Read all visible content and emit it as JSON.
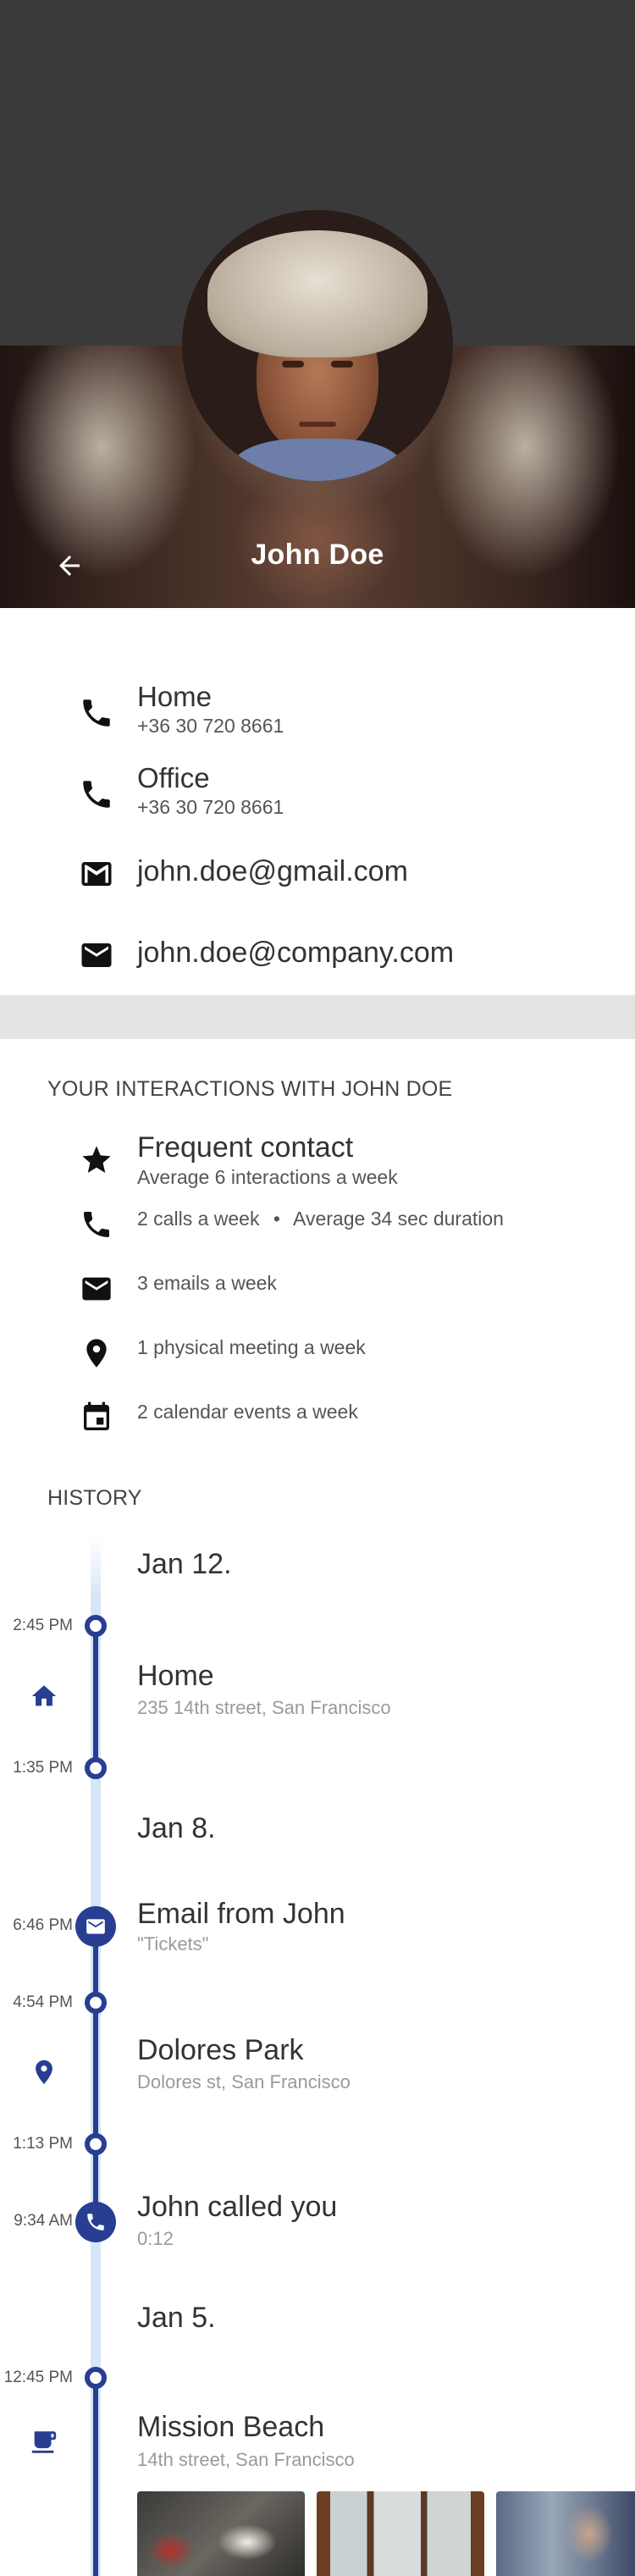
{
  "header": {
    "name": "John Doe",
    "back_icon": "arrow-back-icon"
  },
  "contacts": [
    {
      "icon": "phone-icon",
      "title": "Home",
      "number": "+36 30 720 8661"
    },
    {
      "icon": "phone-icon",
      "title": "Office",
      "number": "+36 30 720 8661"
    },
    {
      "icon": "email-icon",
      "email": "john.doe@gmail.com"
    },
    {
      "icon": "email-icon",
      "email": "john.doe@company.com"
    }
  ],
  "interactions": {
    "title": "YOUR INTERACTIONS WITH JOHN DOE",
    "frequent": {
      "icon": "star-icon",
      "title": "Frequent contact",
      "sub": "Average 6 interactions a week"
    },
    "calls": {
      "icon": "phone-icon",
      "text": "2 calls a week",
      "separator": "•",
      "duration": "Average 34 sec duration"
    },
    "emails": {
      "icon": "email-icon",
      "text": "3 emails a week"
    },
    "meetings": {
      "icon": "location-pin-icon",
      "text": "1 physical meeting a week"
    },
    "calendar": {
      "icon": "calendar-icon",
      "text": "2 calendar events a week"
    }
  },
  "history": {
    "title": "HISTORY",
    "date_1": "Jan 12.",
    "home": {
      "time_start": "2:45 PM",
      "title": "Home",
      "sub": "235 14th street, San Francisco",
      "time_end": "1:35 PM",
      "icon": "home-icon"
    },
    "date_2": "Jan 8.",
    "email": {
      "time": "6:46 PM",
      "title": "Email from John",
      "sub": "\"Tickets\"",
      "icon": "email-icon"
    },
    "park": {
      "time_start": "4:54 PM",
      "title": "Dolores Park",
      "sub": "Dolores st, San Francisco",
      "time_end": "1:13 PM",
      "icon": "location-pin-icon"
    },
    "call": {
      "time": "9:34 AM",
      "title": "John called you",
      "sub": "0:12",
      "icon": "phone-icon"
    },
    "date_3": "Jan 5.",
    "beach": {
      "time": "12:45 PM",
      "title": "Mission Beach",
      "sub": "14th street, San Francisco",
      "icon": "coffee-cup-icon"
    }
  },
  "colors": {
    "accent": "#273e93",
    "timeline_light": "#d6e6f6",
    "divider": "#e4e4e4",
    "header_dark": "#3a3a3a"
  }
}
